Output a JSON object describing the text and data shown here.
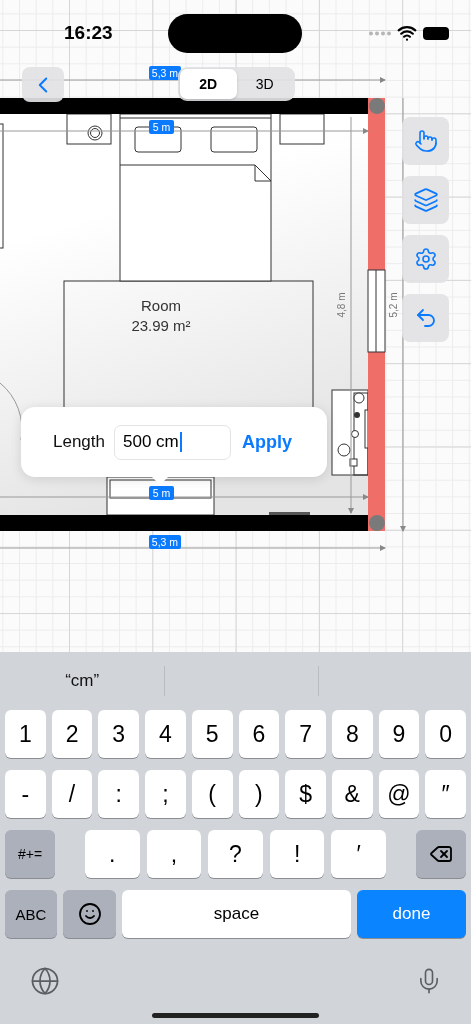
{
  "status_bar": {
    "time": "16:23"
  },
  "view_modes": [
    {
      "label": "2D",
      "selected": true
    },
    {
      "label": "3D",
      "selected": false
    }
  ],
  "plan": {
    "horizontal_dimensions": [
      "5,3 m",
      "5 m",
      "5 m",
      "5,3 m"
    ],
    "vertical_dimensions": [
      "4,8 m",
      "5,2 m"
    ],
    "room": {
      "name": "Room",
      "area": "23.99 m²"
    }
  },
  "length_popup": {
    "label": "Length",
    "value": "500 cm",
    "action": "Apply"
  },
  "keyboard": {
    "suggestions": [
      "“cm”"
    ],
    "number_row": [
      {
        "kind": "char",
        "label": "1"
      },
      {
        "kind": "char",
        "label": "2"
      },
      {
        "kind": "char",
        "label": "3"
      },
      {
        "kind": "char",
        "label": "4"
      },
      {
        "kind": "char",
        "label": "5"
      },
      {
        "kind": "char",
        "label": "6"
      },
      {
        "kind": "char",
        "label": "7"
      },
      {
        "kind": "char",
        "label": "8"
      },
      {
        "kind": "char",
        "label": "9"
      },
      {
        "kind": "char",
        "label": "0"
      }
    ],
    "symbol_row": [
      {
        "kind": "char",
        "label": "-"
      },
      {
        "kind": "char",
        "label": "/"
      },
      {
        "kind": "char",
        "label": ":"
      },
      {
        "kind": "char",
        "label": ";"
      },
      {
        "kind": "char",
        "label": "("
      },
      {
        "kind": "char",
        "label": ")"
      },
      {
        "kind": "char",
        "label": "$"
      },
      {
        "kind": "char",
        "label": "&"
      },
      {
        "kind": "char",
        "label": "@"
      },
      {
        "kind": "char",
        "label": "″"
      }
    ],
    "punctuation_row": [
      {
        "kind": "symbols",
        "label": "#+="
      },
      {
        "kind": "char",
        "label": "."
      },
      {
        "kind": "char",
        "label": ","
      },
      {
        "kind": "char",
        "label": "?"
      },
      {
        "kind": "char",
        "label": "!"
      },
      {
        "kind": "char",
        "label": "′"
      },
      {
        "kind": "delete"
      }
    ],
    "bottom_row": [
      {
        "kind": "abc",
        "label": "ABC"
      },
      {
        "kind": "emoji"
      },
      {
        "kind": "space",
        "label": "space"
      },
      {
        "kind": "done",
        "label": "done"
      }
    ]
  }
}
